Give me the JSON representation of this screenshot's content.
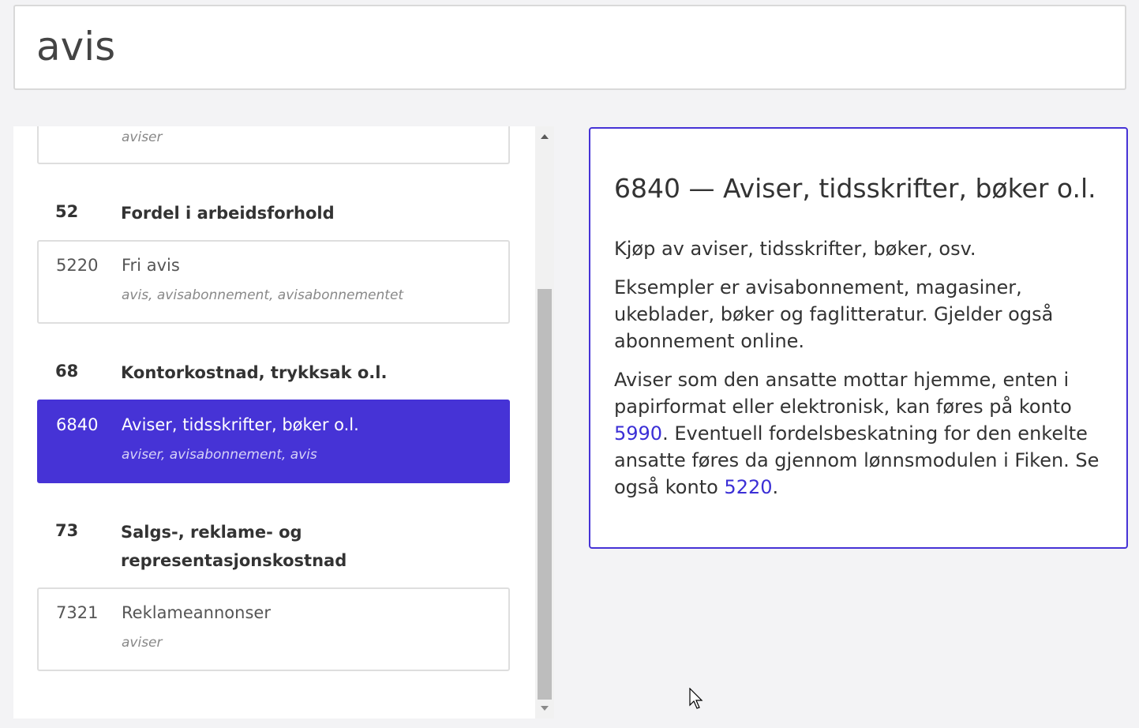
{
  "search": {
    "value": "avis"
  },
  "list": {
    "top_partial_keywords": "aviser",
    "groups": [
      {
        "number": "52",
        "title": "Fordel i arbeidsforhold",
        "accounts": [
          {
            "number": "5220",
            "name": "Fri avis",
            "keywords": "avis, avisabonnement, avisabonnementet"
          }
        ]
      },
      {
        "number": "68",
        "title": "Kontorkostnad, trykksak o.l.",
        "accounts": [
          {
            "number": "6840",
            "name": "Aviser, tidsskrifter, bøker o.l.",
            "keywords": "aviser, avisabonnement, avis",
            "selected": true
          }
        ]
      },
      {
        "number": "73",
        "title_line1": "Salgs-, reklame- og",
        "title_line2": "representasjonskostnad",
        "accounts": [
          {
            "number": "7321",
            "name": "Reklameannonser",
            "keywords": "aviser"
          }
        ]
      }
    ]
  },
  "detail": {
    "title": "6840 — Aviser, tidsskrifter, bøker o.l.",
    "p1": "Kjøp av aviser, tidsskrifter, bøker, osv.",
    "p2": "Eksempler er avisabonnement, magasiner, ukeblader, bøker og faglitteratur. Gjelder også abonnement online.",
    "p3_part1": "Aviser som den ansatte mottar hjemme, enten i papirformat eller elektronisk, kan føres på konto ",
    "p3_link1": "5990",
    "p3_part2": ". Eventuell fordelsbeskatning for den enkelte ansatte føres da gjennom lønnsmodulen i Fiken. Se også konto ",
    "p3_link2": "5220",
    "p3_part3": "."
  },
  "colors": {
    "accent": "#4633d6",
    "background": "#f3f3f5"
  }
}
